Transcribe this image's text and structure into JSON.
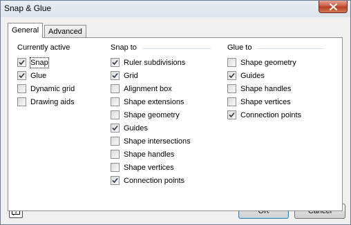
{
  "window": {
    "title": "Snap & Glue"
  },
  "tabs": [
    {
      "label": "General",
      "active": true
    },
    {
      "label": "Advanced",
      "active": false
    }
  ],
  "groups": {
    "currently_active": {
      "header": "Currently active",
      "items": [
        {
          "label": "Snap",
          "checked": true
        },
        {
          "label": "Glue",
          "checked": true
        },
        {
          "label": "Dynamic grid",
          "checked": false
        },
        {
          "label": "Drawing aids",
          "checked": false
        }
      ]
    },
    "snap_to": {
      "header": "Snap to",
      "items": [
        {
          "label": "Ruler subdivisions",
          "checked": true
        },
        {
          "label": "Grid",
          "checked": true
        },
        {
          "label": "Alignment box",
          "checked": false
        },
        {
          "label": "Shape extensions",
          "checked": false
        },
        {
          "label": "Shape geometry",
          "checked": false
        },
        {
          "label": "Guides",
          "checked": true
        },
        {
          "label": "Shape intersections",
          "checked": false
        },
        {
          "label": "Shape handles",
          "checked": false
        },
        {
          "label": "Shape vertices",
          "checked": false
        },
        {
          "label": "Connection points",
          "checked": true
        }
      ]
    },
    "glue_to": {
      "header": "Glue to",
      "items": [
        {
          "label": "Shape geometry",
          "checked": false
        },
        {
          "label": "Guides",
          "checked": true
        },
        {
          "label": "Shape handles",
          "checked": false
        },
        {
          "label": "Shape vertices",
          "checked": false
        },
        {
          "label": "Connection points",
          "checked": true
        }
      ]
    }
  },
  "buttons": {
    "ok": "OK",
    "cancel": "Cancel"
  },
  "icons": {
    "help": "help-icon",
    "close": "close-icon"
  }
}
